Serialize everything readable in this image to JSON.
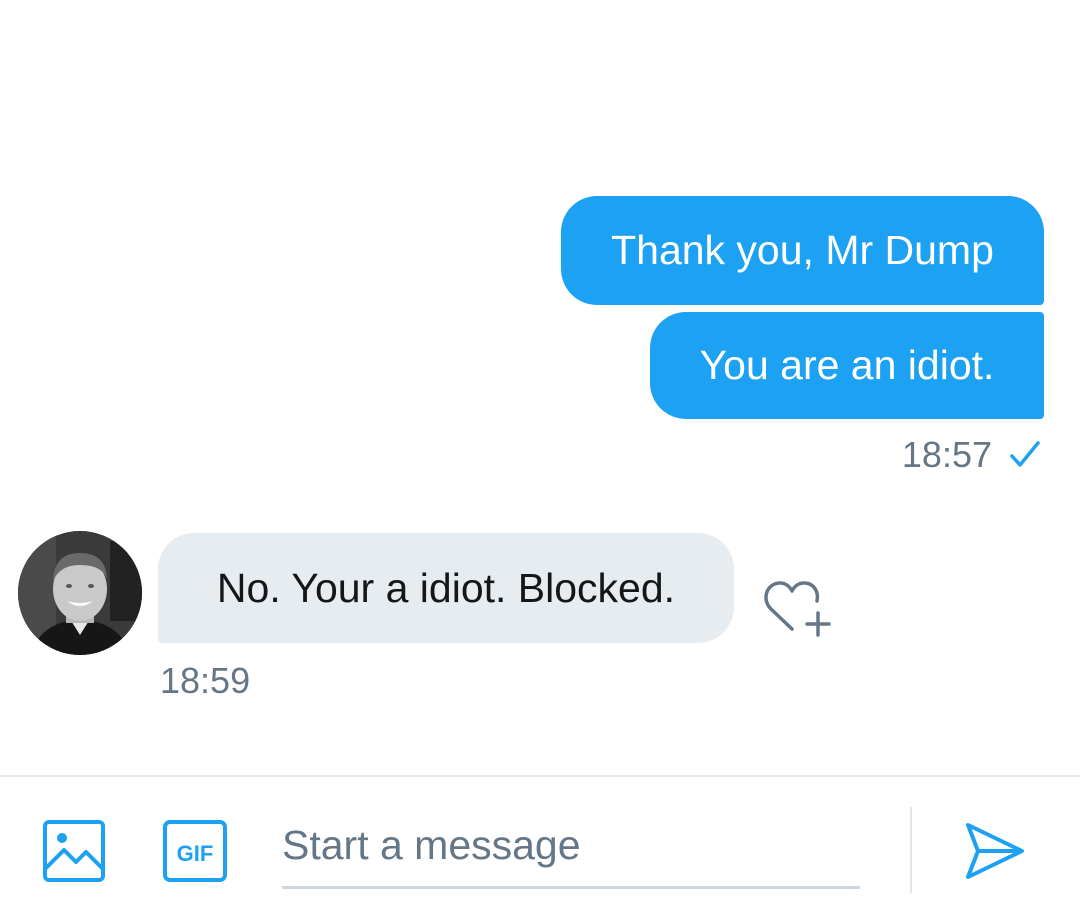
{
  "conversation": {
    "outgoing": [
      {
        "text": "Thank you, Mr Dump"
      },
      {
        "text": "You are an idiot."
      }
    ],
    "outgoing_time": "18:57",
    "outgoing_status_icon": "check-icon",
    "incoming": {
      "text": "No. Your a idiot. Blocked.",
      "time": "18:59",
      "reaction_icon": "heart-plus-icon"
    }
  },
  "composer": {
    "placeholder": "Start a message",
    "media_icon": "image-icon",
    "gif_label": "GIF",
    "send_icon": "send-icon"
  },
  "colors": {
    "accent": "#1da1f2",
    "incoming_bubble": "#e6ecf0",
    "secondary_text": "#657786",
    "primary_text": "#14171a",
    "divider": "#e1e8ed"
  }
}
